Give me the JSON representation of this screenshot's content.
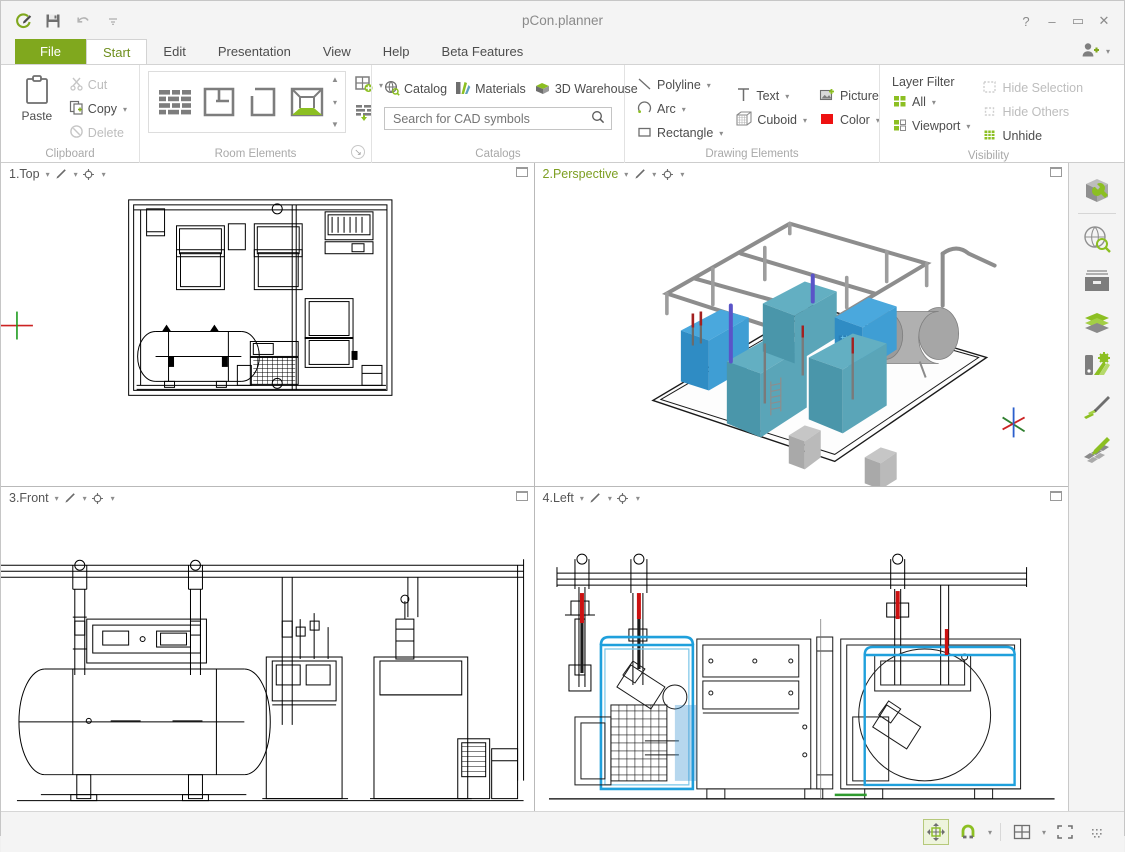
{
  "window": {
    "title": "pCon.planner",
    "quick_access": [
      "app-logo",
      "save-icon",
      "undo-icon",
      "customize-caret"
    ],
    "controls": {
      "help": "?",
      "minimize": "–",
      "maximize": "▭",
      "close": "✕"
    }
  },
  "tabs": [
    {
      "label": "File",
      "type": "file"
    },
    {
      "label": "Start",
      "type": "active"
    },
    {
      "label": "Edit",
      "type": "normal"
    },
    {
      "label": "Presentation",
      "type": "normal"
    },
    {
      "label": "View",
      "type": "normal"
    },
    {
      "label": "Help",
      "type": "normal"
    },
    {
      "label": "Beta Features",
      "type": "normal"
    }
  ],
  "user_button": {
    "name": "account-add-icon",
    "caret": "▾"
  },
  "ribbon": {
    "groups": [
      {
        "name": "clipboard",
        "label": "Clipboard",
        "paste": "Paste",
        "items": [
          {
            "label": "Cut",
            "icon": "cut-icon",
            "disabled": true,
            "caret": ""
          },
          {
            "label": "Copy",
            "icon": "copy-icon",
            "disabled": false,
            "caret": "▾"
          },
          {
            "label": "Delete",
            "icon": "delete-icon",
            "disabled": true,
            "caret": ""
          }
        ]
      },
      {
        "name": "room-elements",
        "label": "Room Elements",
        "dialog_launcher": "↘",
        "gallery": [
          "wall-icon",
          "floorplan-icon",
          "room-opening-icon",
          "room-3d-icon"
        ],
        "scroll": [
          "▲",
          "▾",
          "▼"
        ],
        "side_buttons": [
          "new-room-icon",
          "room-list-icon"
        ],
        "side_caret": "▾"
      },
      {
        "name": "catalogs",
        "label": "Catalogs",
        "items": [
          {
            "label": "Catalog",
            "icon": "catalog-globe-icon"
          },
          {
            "label": "Materials",
            "icon": "materials-icon"
          },
          {
            "label": "3D Warehouse",
            "icon": "warehouse-icon"
          }
        ],
        "search": {
          "placeholder": "Search for CAD symbols",
          "value": "",
          "icon": "search-icon"
        }
      },
      {
        "name": "drawing-elements",
        "label": "Drawing Elements",
        "items": [
          {
            "label": "Polyline",
            "icon": "polyline-icon",
            "caret": "▾"
          },
          {
            "label": "Arc",
            "icon": "arc-icon",
            "caret": "▾"
          },
          {
            "label": "Rectangle",
            "icon": "rectangle-icon",
            "caret": "▾"
          },
          {
            "label": "Text",
            "icon": "text-icon",
            "caret": "▾"
          },
          {
            "label": "Cuboid",
            "icon": "cuboid-icon",
            "caret": "▾"
          },
          {
            "label": "Picture",
            "icon": "picture-icon",
            "caret": ""
          },
          {
            "label": "Color",
            "icon": "color-swatch-icon",
            "caret": "▾"
          }
        ],
        "color_value": "#ee1111"
      },
      {
        "name": "visibility",
        "label": "Visibility",
        "dialog_launcher": "↑",
        "title": "Layer Filter",
        "items": [
          {
            "label": "All",
            "icon": "layers-all-icon",
            "caret": "▾",
            "disabled": false
          },
          {
            "label": "Viewport",
            "icon": "layers-viewport-icon",
            "caret": "▾",
            "disabled": false
          },
          {
            "label": "Hide Selection",
            "icon": "hide-selection-icon",
            "caret": "",
            "disabled": true
          },
          {
            "label": "Hide Others",
            "icon": "hide-others-icon",
            "caret": "",
            "disabled": true
          },
          {
            "label": "Unhide",
            "icon": "unhide-icon",
            "caret": "",
            "disabled": false
          }
        ]
      }
    ]
  },
  "viewports": [
    {
      "name": "1.Top",
      "active": false,
      "caret": "▾",
      "render_icon": "render-mode-icon",
      "camera_icon": "camera-icon",
      "maximize": "restore-icon"
    },
    {
      "name": "2.Perspective",
      "active": true,
      "caret": "▾",
      "render_icon": "render-mode-icon",
      "camera_icon": "camera-icon",
      "maximize": "restore-icon"
    },
    {
      "name": "3.Front",
      "active": false,
      "caret": "▾",
      "render_icon": "render-mode-icon",
      "camera_icon": "camera-icon",
      "maximize": "restore-icon"
    },
    {
      "name": "4.Left",
      "active": false,
      "caret": "▾",
      "render_icon": "render-mode-icon",
      "camera_icon": "camera-icon",
      "maximize": "restore-icon"
    }
  ],
  "sidebar": {
    "items": [
      {
        "name": "object-properties-icon"
      },
      {
        "name": "catalog-search-icon"
      },
      {
        "name": "archive-icon"
      },
      {
        "name": "layers-icon"
      },
      {
        "name": "materials-palette-icon"
      },
      {
        "name": "drawing-pen-icon"
      },
      {
        "name": "rendering-icon"
      }
    ]
  },
  "statusbar": {
    "items": [
      {
        "name": "move-gizmo-toggle",
        "active": true,
        "caret": ""
      },
      {
        "name": "snap-magnet-toggle",
        "active": false,
        "caret": "▾"
      },
      {
        "name": "viewport-layout-button",
        "active": false,
        "caret": "▾"
      },
      {
        "name": "fullscreen-button",
        "active": false,
        "caret": ""
      },
      {
        "name": "grid-snap-button",
        "active": false,
        "caret": ""
      }
    ]
  },
  "colors": {
    "accent_green": "#80a81e",
    "active_tab_text": "#6f8f1e",
    "titlebar_bg": "#f4f4f4",
    "ribbon_bg": "#ffffff",
    "viewport_bg": "#ffffff",
    "model_blue": "#3c9fd4",
    "model_teal": "#4e9cb0",
    "model_grey": "#9a9a9a",
    "color_swatch": "#ee1111"
  }
}
